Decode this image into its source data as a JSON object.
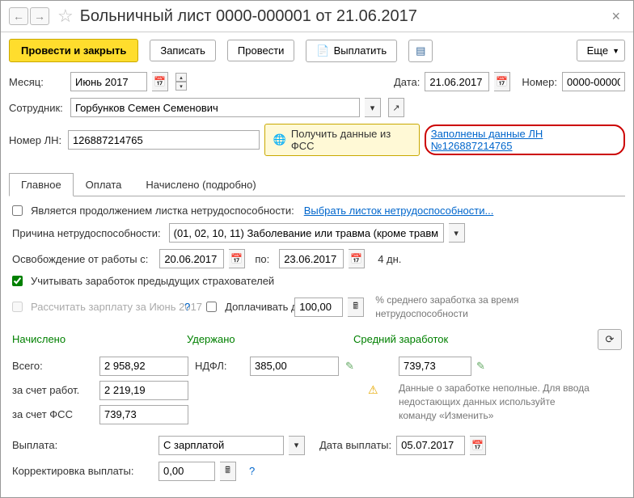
{
  "title": "Больничный лист 0000-000001 от 21.06.2017",
  "toolbar": {
    "post_close": "Провести и закрыть",
    "save": "Записать",
    "post": "Провести",
    "pay": "Выплатить",
    "more": "Еще"
  },
  "header": {
    "month_lbl": "Месяц:",
    "month_val": "Июнь 2017",
    "date_lbl": "Дата:",
    "date_val": "21.06.2017",
    "num_lbl": "Номер:",
    "num_val": "0000-00000",
    "employee_lbl": "Сотрудник:",
    "employee_val": "Горбунков Семен Семенович",
    "ln_lbl": "Номер ЛН:",
    "ln_val": "126887214765",
    "fss_btn": "Получить данные из ФСС",
    "filled_link": "Заполнены данные ЛН №126887214765"
  },
  "tabs": {
    "main": "Главное",
    "pay": "Оплата",
    "accrued": "Начислено (подробно)"
  },
  "main": {
    "continuation_lbl": "Является продолжением листка нетрудоспособности:",
    "select_sheet": "Выбрать листок нетрудоспособности...",
    "reason_lbl": "Причина нетрудоспособности:",
    "reason_val": "(01, 02, 10, 11) Заболевание или травма (кроме травм",
    "release_lbl": "Освобождение от работы с:",
    "release_from": "20.06.2017",
    "release_to_lbl": "по:",
    "release_to": "23.06.2017",
    "days": "4 дн.",
    "prev_insurers": "Учитывать заработок предыдущих страхователей",
    "calc_salary": "Рассчитать зарплату за Июнь 2017",
    "extra_pay": "Доплачивать до",
    "extra_val": "100,00",
    "percent_text": "% среднего заработка за время нетрудоспособности",
    "h_accrued": "Начислено",
    "h_withheld": "Удержано",
    "h_avg": "Средний заработок",
    "total_lbl": "Всего:",
    "total_val": "2 958,92",
    "ndfl_lbl": "НДФЛ:",
    "ndfl_val": "385,00",
    "avg_val": "739,73",
    "employer_lbl": "за счет работ.",
    "employer_val": "2 219,19",
    "fss_lbl": "за счет ФСС",
    "fss_val": "739,73",
    "warn_text": "Данные о заработке неполные. Для ввода недостающих данных используйте команду «Изменить»",
    "payment_lbl": "Выплата:",
    "payment_val": "С зарплатой",
    "pay_date_lbl": "Дата выплаты:",
    "pay_date_val": "05.07.2017",
    "corr_lbl": "Корректировка выплаты:",
    "corr_val": "0,00"
  }
}
